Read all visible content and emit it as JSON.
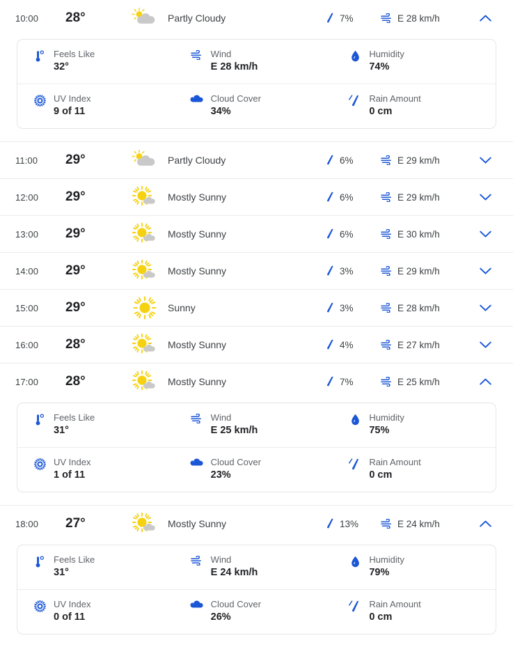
{
  "labels": {
    "feels_like": "Feels Like",
    "wind": "Wind",
    "humidity": "Humidity",
    "uv_index": "UV Index",
    "cloud_cover": "Cloud Cover",
    "rain_amount": "Rain Amount"
  },
  "colors": {
    "accent_blue": "#1a56d6",
    "sun_yellow": "#f7d117",
    "cloud_gray": "#c8c8c8",
    "text_primary": "#202124",
    "text_secondary": "#5f6368",
    "row_divider": "#ebebeb",
    "panel_border": "#e4e6e8"
  },
  "icons": {
    "partly_cloudy": "partly-cloudy-icon",
    "mostly_sunny": "mostly-sunny-icon",
    "sunny": "sunny-icon",
    "precipitation": "raindrop-icon",
    "wind": "wind-icon",
    "chevron_down": "chevron-down-icon",
    "chevron_up": "chevron-up-icon",
    "thermometer": "thermometer-icon",
    "uv": "uv-sun-icon",
    "humidity": "water-drop-icon",
    "cloud": "cloud-icon",
    "rain": "rain-drops-icon"
  },
  "hours": [
    {
      "time": "10:00",
      "temp": "28°",
      "icon": "partly_cloudy",
      "condition": "Partly Cloudy",
      "precip": "7%",
      "wind": "E 28 km/h",
      "expanded": true,
      "details": {
        "feels_like": "32°",
        "wind": "E 28 km/h",
        "humidity": "74%",
        "uv_index": "9 of 11",
        "cloud_cover": "34%",
        "rain_amount": "0 cm"
      }
    },
    {
      "time": "11:00",
      "temp": "29°",
      "icon": "partly_cloudy",
      "condition": "Partly Cloudy",
      "precip": "6%",
      "wind": "E 29 km/h",
      "expanded": false
    },
    {
      "time": "12:00",
      "temp": "29°",
      "icon": "mostly_sunny",
      "condition": "Mostly Sunny",
      "precip": "6%",
      "wind": "E 29 km/h",
      "expanded": false
    },
    {
      "time": "13:00",
      "temp": "29°",
      "icon": "mostly_sunny",
      "condition": "Mostly Sunny",
      "precip": "6%",
      "wind": "E 30 km/h",
      "expanded": false
    },
    {
      "time": "14:00",
      "temp": "29°",
      "icon": "mostly_sunny",
      "condition": "Mostly Sunny",
      "precip": "3%",
      "wind": "E 29 km/h",
      "expanded": false
    },
    {
      "time": "15:00",
      "temp": "29°",
      "icon": "sunny",
      "condition": "Sunny",
      "precip": "3%",
      "wind": "E 28 km/h",
      "expanded": false
    },
    {
      "time": "16:00",
      "temp": "28°",
      "icon": "mostly_sunny",
      "condition": "Mostly Sunny",
      "precip": "4%",
      "wind": "E 27 km/h",
      "expanded": false
    },
    {
      "time": "17:00",
      "temp": "28°",
      "icon": "mostly_sunny",
      "condition": "Mostly Sunny",
      "precip": "7%",
      "wind": "E 25 km/h",
      "expanded": true,
      "details": {
        "feels_like": "31°",
        "wind": "E 25 km/h",
        "humidity": "75%",
        "uv_index": "1 of 11",
        "cloud_cover": "23%",
        "rain_amount": "0 cm"
      }
    },
    {
      "time": "18:00",
      "temp": "27°",
      "icon": "mostly_sunny",
      "condition": "Mostly Sunny",
      "precip": "13%",
      "wind": "E 24 km/h",
      "expanded": true,
      "details": {
        "feels_like": "31°",
        "wind": "E 24 km/h",
        "humidity": "79%",
        "uv_index": "0 of 11",
        "cloud_cover": "26%",
        "rain_amount": "0 cm"
      }
    }
  ]
}
